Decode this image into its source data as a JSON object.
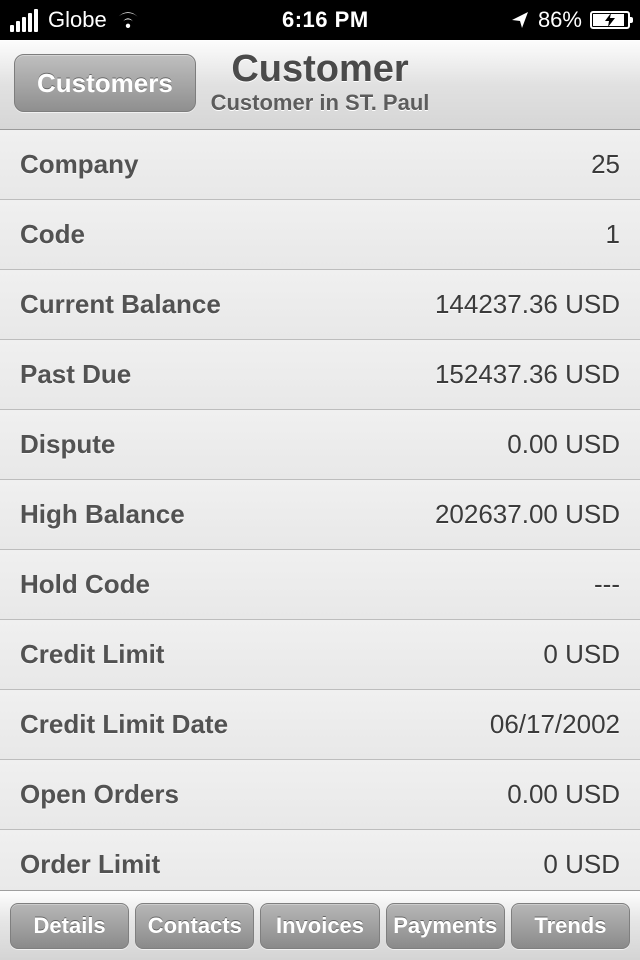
{
  "status_bar": {
    "carrier": "Globe",
    "time": "6:16 PM",
    "battery_percent": "86%"
  },
  "nav": {
    "back_label": "Customers",
    "title": "Customer",
    "subtitle": "Customer in ST. Paul"
  },
  "rows": [
    {
      "label": "Company",
      "value": "25"
    },
    {
      "label": "Code",
      "value": "1"
    },
    {
      "label": "Current Balance",
      "value": "144237.36 USD"
    },
    {
      "label": "Past Due",
      "value": "152437.36 USD"
    },
    {
      "label": "Dispute",
      "value": "0.00 USD"
    },
    {
      "label": "High Balance",
      "value": "202637.00 USD"
    },
    {
      "label": "Hold Code",
      "value": "---"
    },
    {
      "label": "Credit Limit",
      "value": "0 USD"
    },
    {
      "label": "Credit Limit Date",
      "value": "06/17/2002"
    },
    {
      "label": "Open Orders",
      "value": "0.00 USD"
    },
    {
      "label": "Order Limit",
      "value": "0 USD"
    }
  ],
  "tabs": [
    {
      "label": "Details"
    },
    {
      "label": "Contacts"
    },
    {
      "label": "Invoices"
    },
    {
      "label": "Payments"
    },
    {
      "label": "Trends"
    }
  ]
}
